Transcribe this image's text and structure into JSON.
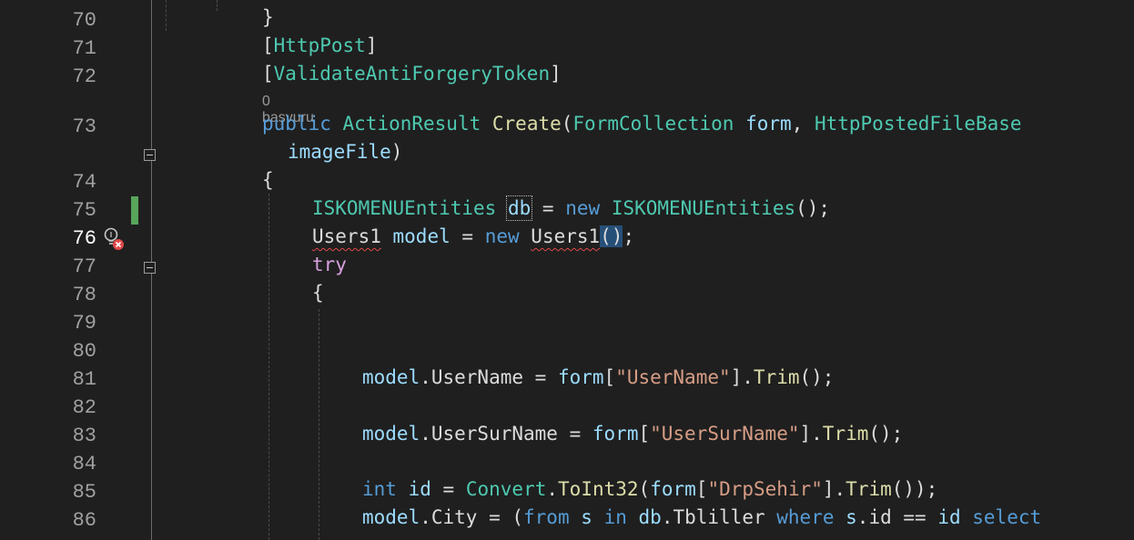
{
  "editor": {
    "line_numbers": [
      "70",
      "71",
      "72",
      "73",
      "74",
      "75",
      "76",
      "77",
      "78",
      "79",
      "80",
      "81",
      "82",
      "83",
      "84",
      "85",
      "86"
    ],
    "current_line": "76",
    "codelens": "0 başvuru",
    "code": {
      "l70_brace": "}",
      "l71_open": "[",
      "l71_attr": "HttpPost",
      "l71_close": "]",
      "l72_open": "[",
      "l72_attr": "ValidateAntiForgeryToken",
      "l72_close": "]",
      "l73_public": "public",
      "l73_ret": "ActionResult",
      "l73_name": "Create",
      "l73_p1": "(",
      "l73_type1": "FormCollection",
      "l73_param1": "form",
      "l73_comma": ",",
      "l73_type2": "HttpPostedFileBase",
      "l73b_param2": "imageFile",
      "l73b_close": ")",
      "l74_brace": "{",
      "l75_type": "ISKOMENUEntities",
      "l75_var": "db",
      "l75_eq": "=",
      "l75_new": "new",
      "l75_type2": "ISKOMENUEntities",
      "l75_end": "();",
      "l76_type": "Users1",
      "l76_var": "model",
      "l76_eq": "=",
      "l76_new": "new",
      "l76_type2": "Users1",
      "l76_paren": "()",
      "l76_semi": ";",
      "l77_try": "try",
      "l78_brace": "{",
      "l81_obj": "model",
      "l81_prop": ".UserName =",
      "l81_form": "form",
      "l81_open": "[",
      "l81_str": "\"UserName\"",
      "l81_close": "].",
      "l81_trim": "Trim",
      "l81_end": "();",
      "l83_obj": "model",
      "l83_prop": ".UserSurName =",
      "l83_form": "form",
      "l83_open": "[",
      "l83_str": "\"UserSurName\"",
      "l83_close": "].",
      "l83_trim": "Trim",
      "l83_end": "();",
      "l85_int": "int",
      "l85_id": "id",
      "l85_eq": "=",
      "l85_conv": "Convert",
      "l85_dot": ".",
      "l85_toint": "ToInt32",
      "l85_p": "(",
      "l85_form": "form",
      "l85_open": "[",
      "l85_str": "\"DrpSehir\"",
      "l85_close": "].",
      "l85_trim": "Trim",
      "l85_end": "());",
      "l86_obj": "model",
      "l86_prop": ".City = (",
      "l86_from": "from",
      "l86_s": "s",
      "l86_in": "in",
      "l86_db": "db",
      "l86_tbl": ".Tbliller",
      "l86_where": "where",
      "l86_sid": "s",
      "l86_dotid": ".id ==",
      "l86_id": "id",
      "l86_select": "select"
    }
  },
  "colors": {
    "background": "#1f1f1f",
    "keyword": "#569cd6",
    "control_keyword": "#d8a0df",
    "type": "#4ec9b0",
    "method": "#dcdcaa",
    "parameter": "#9cdcfe",
    "string": "#d69d85",
    "change_bar": "#58a55c",
    "error_squiggle": "#e04848"
  },
  "icons": {
    "lightbulb_error": "lightbulb-error-icon",
    "collapse": "collapse-minus-icon"
  }
}
